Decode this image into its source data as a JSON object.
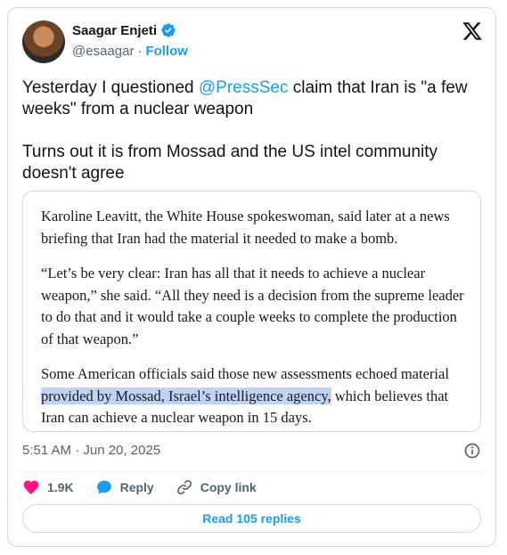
{
  "author": {
    "name": "Saagar Enjeti",
    "handle": "@esaagar",
    "separator": "·",
    "follow_label": "Follow"
  },
  "tweet": {
    "line1_prefix": "Yesterday I questioned ",
    "mention": "@PressSec",
    "line1_suffix": " claim that Iran is \"a few weeks\" from a nuclear weapon",
    "line2": "Turns out it is from Mossad and the US intel community doesn't agree"
  },
  "quote_image": {
    "para1": "Karoline Leavitt, the White House spokeswoman, said later at a news briefing that Iran had the material it needed to make a bomb.",
    "para2": "“Let’s be very clear: Iran has all that it needs to achieve a nuclear weapon,” she said. “All they need is a decision from the supreme leader to do that and it would take a couple weeks to complete the production of that weapon.”",
    "para3_prefix": "Some American officials said those new assessments  echoed material ",
    "para3_highlight": "provided by Mossad, Israel’s intelligence agency,",
    "para3_suffix": " which believes that Iran can achieve a nuclear weapon in 15 days."
  },
  "meta": {
    "timestamp": "5:51 AM · Jun 20, 2025"
  },
  "actions": {
    "likes": "1.9K",
    "reply_label": "Reply",
    "copy_label": "Copy link",
    "read_replies": "Read 105 replies"
  },
  "colors": {
    "accent": "#1d9bf0",
    "like": "#f91880",
    "highlight": "#bfd3f5"
  },
  "icons": [
    "verified-badge-icon",
    "x-logo-icon",
    "info-icon",
    "heart-icon",
    "reply-bubble-icon",
    "link-icon"
  ]
}
